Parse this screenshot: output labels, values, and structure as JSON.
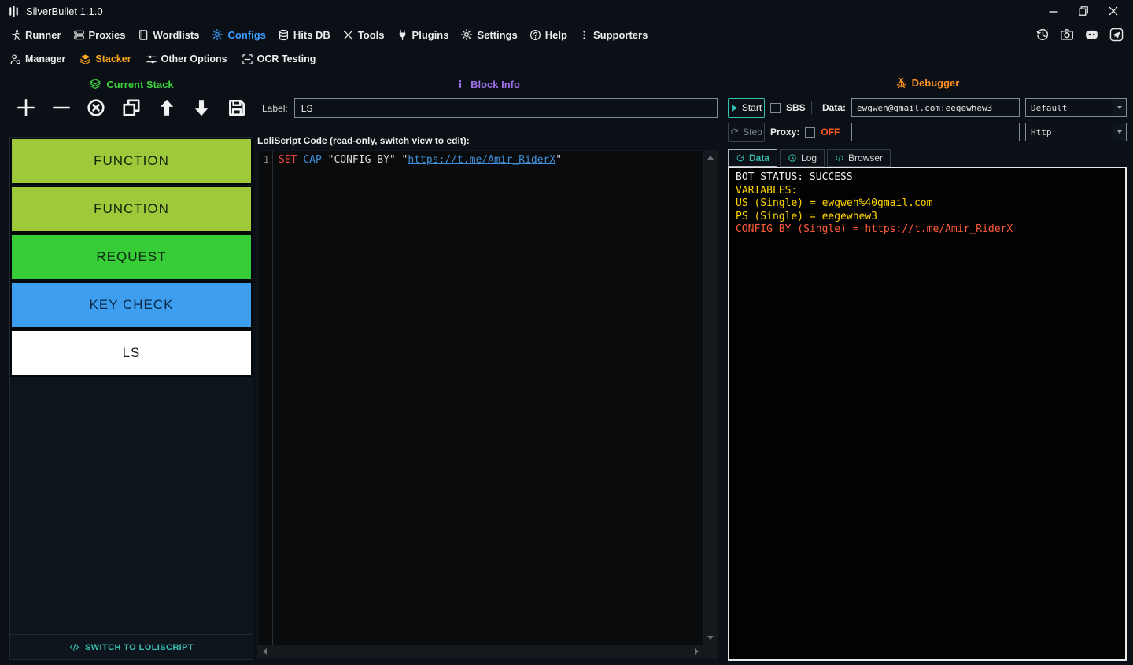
{
  "window": {
    "title": "SilverBullet 1.1.0"
  },
  "menubar": {
    "items": [
      {
        "label": "Runner"
      },
      {
        "label": "Proxies"
      },
      {
        "label": "Wordlists"
      },
      {
        "label": "Configs"
      },
      {
        "label": "Hits DB"
      },
      {
        "label": "Tools"
      },
      {
        "label": "Plugins"
      },
      {
        "label": "Settings"
      },
      {
        "label": "Help"
      },
      {
        "label": "Supporters"
      }
    ],
    "active_item": "Configs",
    "active_color": "#3b9eff"
  },
  "submenu": {
    "items": [
      {
        "label": "Manager"
      },
      {
        "label": "Stacker"
      },
      {
        "label": "Other Options"
      },
      {
        "label": "OCR Testing"
      }
    ],
    "active_item": "Stacker",
    "active_color": "#ffa51e"
  },
  "stack_panel": {
    "title": "Current Stack",
    "title_color": "#3ecf3e",
    "blocks": [
      {
        "label": "FUNCTION",
        "color": "#9dc93a",
        "text_color": "#18240a"
      },
      {
        "label": "FUNCTION",
        "color": "#9dc93a",
        "text_color": "#18240a"
      },
      {
        "label": "REQUEST",
        "color": "#37cd37",
        "text_color": "#0d2612"
      },
      {
        "label": "KEY CHECK",
        "color": "#3d9ef0",
        "text_color": "#0c2742"
      },
      {
        "label": "LS",
        "color": "#ffffff",
        "text_color": "#1a1a1e",
        "selected": true
      }
    ],
    "switch_button_label": "SWITCH TO LOLISCRIPT",
    "switch_button_color": "#35c0b0"
  },
  "block_info": {
    "title": "Block Info",
    "title_color": "#9d6fe8",
    "label_caption": "Label:",
    "label_value": "LS",
    "code_caption": "LoliScript Code (read-only, switch view to edit):",
    "code_line_number": "1",
    "code_tokens": [
      {
        "text": "SET ",
        "color": "#e8463c"
      },
      {
        "text": "CAP ",
        "color": "#3f8fd9"
      },
      {
        "text": "\"CONFIG BY\" ",
        "color": "#d8d8d8"
      },
      {
        "text": "\"",
        "color": "#d8d8d8"
      },
      {
        "text": "https://t.me/Amir_RiderX",
        "color": "#3f8fd9",
        "underline": true
      },
      {
        "text": "\"",
        "color": "#d8d8d8"
      }
    ]
  },
  "debugger": {
    "title": "Debugger",
    "title_color": "#ff9021",
    "start_label": "Start",
    "step_label": "Step",
    "sbs_label": "SBS",
    "data_label": "Data:",
    "data_value": "ewgweh@gmail.com:eegewhew3",
    "data_type_value": "Default",
    "proxy_label": "Proxy:",
    "proxy_status": "OFF",
    "proxy_status_color": "#ff5a1e",
    "proxy_value": "",
    "proxy_type_value": "Http",
    "tabs": [
      {
        "label": "Data"
      },
      {
        "label": "Log"
      },
      {
        "label": "Browser"
      }
    ],
    "active_tab": "Data",
    "output_lines": [
      {
        "text": "BOT STATUS: SUCCESS",
        "color": "#f2f2f2"
      },
      {
        "text": "VARIABLES:",
        "color": "#ffd400"
      },
      {
        "text": "US (Single) = ewgweh%40gmail.com",
        "color": "#ffd400"
      },
      {
        "text": "PS (Single) = eegewhew3",
        "color": "#ffd400"
      },
      {
        "text": "CONFIG BY (Single) = https://t.me/Amir_RiderX",
        "color": "#ff5c3c"
      }
    ]
  }
}
